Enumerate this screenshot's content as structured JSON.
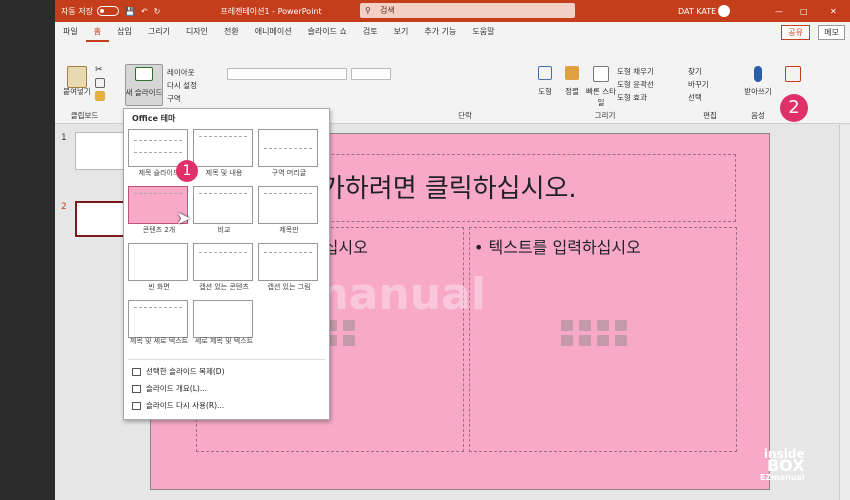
{
  "titlebar": {
    "autosave": "자동 저장",
    "toggle": "끔",
    "doc_title": "프레젠테이션1 - PowerPoint",
    "search": "검색",
    "user": "DAT KATE"
  },
  "tabs": [
    "파일",
    "홈",
    "삽입",
    "그리기",
    "디자인",
    "전환",
    "애니메이션",
    "슬라이드 쇼",
    "검토",
    "보기",
    "추가 기능",
    "도움말"
  ],
  "share_label": "공유",
  "memo_label": "메모",
  "ribbon": {
    "paste": "붙여넣기",
    "clipboard": "클립보드",
    "new_slide": "새 슬라이드",
    "layout": "레이아웃",
    "reset": "다시 설정",
    "section": "구역",
    "paragraph": "단락",
    "shape": "도형",
    "arrange": "정렬",
    "quick_style": "빠른 스타일",
    "fill": "도형 채우기",
    "outline": "도형 윤곽선",
    "effect": "도형 효과",
    "drawing": "그리기",
    "find": "찾기",
    "replace": "바꾸기",
    "select": "선택",
    "edit": "편집",
    "dictate": "받아쓰기",
    "voice": "음성",
    "designer": "디자인 아이디어"
  },
  "thumbnails": [
    "1",
    "2"
  ],
  "dropdown": {
    "header": "Office 테마",
    "layouts": [
      "제목 슬라이드",
      "제목 및 내용",
      "구역 머리글",
      "콘텐츠 2개",
      "비교",
      "제목만",
      "빈 화면",
      "캡션 있는 콘텐츠",
      "캡션 있는 그림",
      "제목 및 세로 텍스트",
      "세로 제목 및 텍스트"
    ],
    "items": [
      "선택한 슬라이드 복제(D)",
      "슬라이드 개요(L)...",
      "슬라이드 다시 사용(R)..."
    ]
  },
  "slide": {
    "title": "제목을 추가하려면 클릭하십시오.",
    "left_body": "• 텍스트를 입력하십시오",
    "right_body": "• 텍스트를 입력하십시오"
  },
  "badges": [
    "1",
    "2"
  ],
  "watermark": {
    "line1": "inside",
    "line2": "BOX",
    "line3": "EZmanual"
  },
  "slide_watermark": "EZmanual"
}
